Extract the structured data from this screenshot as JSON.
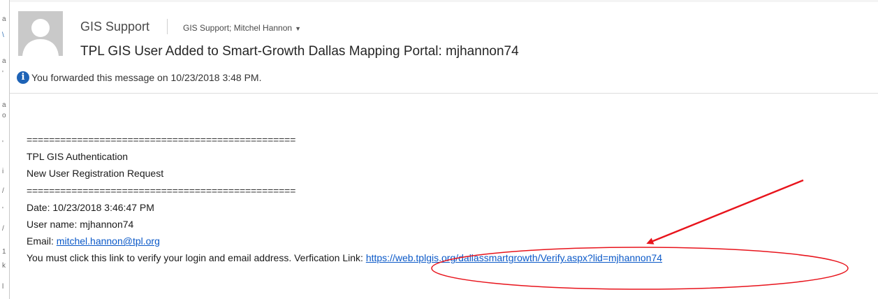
{
  "email": {
    "sender": "GIS Support",
    "recipients": "GIS Support; Mitchel Hannon",
    "subject": "TPL GIS User Added to Smart-Growth Dallas Mapping Portal: mjhannon74",
    "info_message": "You forwarded this message on 10/23/2018 3:48 PM."
  },
  "body": {
    "rule": "================================================",
    "heading1": "TPL GIS Authentication",
    "heading2": "New User Registration Request",
    "date_line": "Date: 10/23/2018 3:46:47 PM",
    "username_line": "User name: mjhannon74",
    "email_label": "Email: ",
    "email_value": "mitchel.hannon@tpl.org",
    "verify_text": "You must click this link to verify your login and email address. Verfication Link: ",
    "verify_link": "https://web.tplgis.org/dallassmartgrowth/Verify.aspx?lid=mjhannon74"
  },
  "icons": {
    "avatar": "person-silhouette-icon",
    "info": "info-icon",
    "dropdown": "chevron-down-icon"
  },
  "colors": {
    "link": "#0b59c8",
    "info_icon": "#1e63b6",
    "annotation": "#e8141c"
  }
}
